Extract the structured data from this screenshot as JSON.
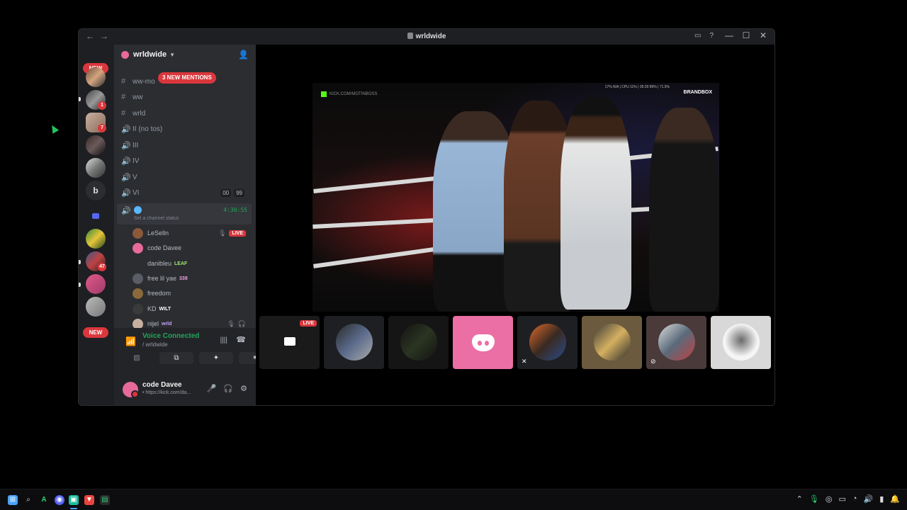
{
  "window": {
    "title": "wrldwide",
    "back": "←",
    "forward": "→",
    "inbox_icon": "inbox-icon",
    "help": "?",
    "minimize": "—",
    "maximize": "☐",
    "close": "✕"
  },
  "servers": {
    "new_top": "NEW",
    "new_bottom": "NEW",
    "badges": [
      "1",
      "7",
      "47"
    ],
    "text_server": "b"
  },
  "guild": {
    "name": "wrldwide",
    "new_mentions": "3 NEW MENTIONS"
  },
  "channels": [
    {
      "icon": "#",
      "name": "ww-mo"
    },
    {
      "icon": "#",
      "name": "ww"
    },
    {
      "icon": "#",
      "name": "wrld"
    },
    {
      "icon": "🔊",
      "name": "II (no tos)"
    },
    {
      "icon": "🔊",
      "name": "III"
    },
    {
      "icon": "🔊",
      "name": "IV"
    },
    {
      "icon": "🔊",
      "name": "V"
    },
    {
      "icon": "🔊",
      "name": "VI",
      "count_a": "00",
      "count_b": "99"
    }
  ],
  "active_channel": {
    "timer": "4:30:55",
    "status": "Set a channel status"
  },
  "members": [
    {
      "name": "LeSelln",
      "badge": "LIVE"
    },
    {
      "name": "code Davee"
    },
    {
      "name": "danibleu",
      "tag": "LEAF"
    },
    {
      "name": "free lil yae",
      "tag": "338"
    },
    {
      "name": "freedom"
    },
    {
      "name": "KD",
      "tag": "WILT"
    },
    {
      "name": "nijel",
      "tag": "wrld"
    }
  ],
  "voice": {
    "title": "Voice Connected",
    "subtitle": "/ wrldwide"
  },
  "user": {
    "name": "code Davee",
    "status": "• https://kick.com/da..."
  },
  "stream": {
    "watermark": "KICK.COM/MOTINBOSS",
    "brand": "BRANDBOX",
    "stats": "17% N/A | CPU 11% | 05:39 89% | 71.5%"
  },
  "tiles": [
    {
      "name": "screen-share",
      "live": "LIVE"
    },
    {
      "name": "participant-2"
    },
    {
      "name": "participant-3"
    },
    {
      "name": "discord-default"
    },
    {
      "name": "participant-5"
    },
    {
      "name": "participant-6"
    },
    {
      "name": "participant-7"
    },
    {
      "name": "participant-8"
    }
  ],
  "colors": {
    "accent_green": "#23a55a",
    "live_red": "#da373c",
    "blurple": "#5865f2",
    "pink": "#eb6fa5"
  }
}
